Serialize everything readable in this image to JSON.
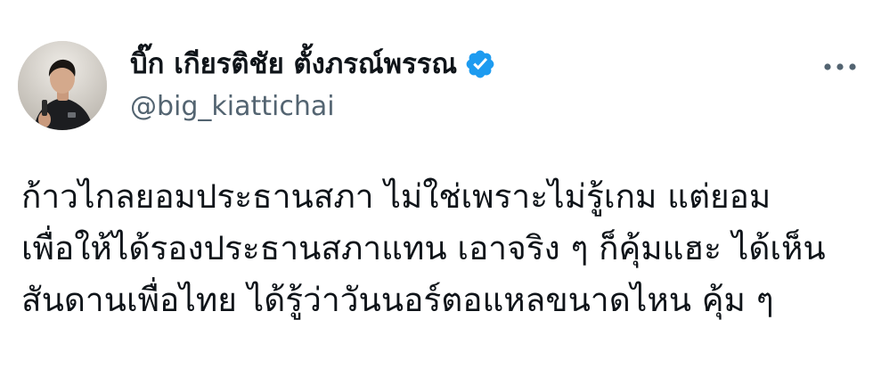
{
  "author": {
    "display_name": "บิ๊ก เกียรติชัย ตั้งภรณ์พรรณ",
    "handle": "@big_kiattichai",
    "verified": true,
    "verified_color": "#1d9bf0",
    "avatar_icon": "profile-photo"
  },
  "menu": {
    "more_icon": "more-horizontal-icon"
  },
  "tweet": {
    "lines": [
      "ก้าวไกลยอมประธานสภา ไม่ใช่เพราะไม่รู้เกม แต่ยอม",
      "เพื่อให้ได้รองประธานสภาแทน เอาจริง ๆ ก็คุ้มแฮะ ได้เห็น",
      "สันดานเพื่อไทย ได้รู้ว่าวันนอร์ตอแหลขนาดไหน คุ้ม ๆ"
    ]
  },
  "colors": {
    "text_primary": "#0f1419",
    "text_secondary": "#536471",
    "background": "#ffffff"
  }
}
